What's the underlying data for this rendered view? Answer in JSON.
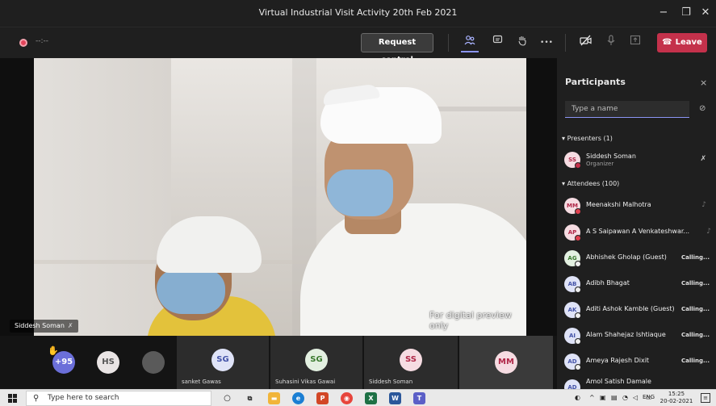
{
  "window": {
    "title": "Virtual Industrial Visit Activity 20th Feb 2021",
    "minimize": "−",
    "restore": "❐",
    "close": "✕"
  },
  "toolbar": {
    "timer": "--:--",
    "request_control": "Request control",
    "more": "•••",
    "leave": "Leave",
    "leave_icon": "☎"
  },
  "stage": {
    "presenter_name": "Siddesh Soman",
    "watermark": "For digital preview only"
  },
  "strip": {
    "overflow_count": "+95",
    "tiles": [
      {
        "initials": "HS",
        "label": ""
      },
      {
        "initials": "SG",
        "label": "sanket Gawas"
      },
      {
        "initials": "SG",
        "label": "Suhasini Vikas Gawai"
      },
      {
        "initials": "SS",
        "label": "Siddesh Soman"
      },
      {
        "initials": "MM",
        "label": ""
      }
    ]
  },
  "panel": {
    "title": "Participants",
    "close": "×",
    "search_placeholder": "Type a name",
    "presenters_header": "Presenters (1)",
    "attendees_header": "Attendees (100)",
    "presenters": [
      {
        "initials": "SS",
        "name": "Siddesh Soman",
        "role": "Organizer"
      }
    ],
    "attendees": [
      {
        "initials": "MM",
        "name": "Meenakshi Malhotra",
        "status": "",
        "color": "#e0404f"
      },
      {
        "initials": "AP",
        "name": "A S Saipawan A Venkateshwar...",
        "status": "",
        "color": "#e0404f"
      },
      {
        "initials": "AG",
        "name": "Abhishek Gholap (Guest)",
        "status": "Calling...",
        "color": "#eeeeee"
      },
      {
        "initials": "AB",
        "name": "Adibh Bhagat",
        "status": "Calling...",
        "color": "#eeeeee"
      },
      {
        "initials": "AK",
        "name": "Aditi Ashok Kamble (Guest)",
        "status": "Calling...",
        "color": "#eeeeee"
      },
      {
        "initials": "AI",
        "name": "Alam Shahejaz Ishtiaque",
        "status": "Calling...",
        "color": "#eeeeee"
      },
      {
        "initials": "AD",
        "name": "Ameya Rajesh Dixit",
        "status": "Calling...",
        "color": "#eeeeee"
      },
      {
        "initials": "AD",
        "name": "Amol Satish Damale",
        "status": "",
        "color": "#eeeeee"
      }
    ]
  },
  "taskbar": {
    "search_placeholder": "Type here to search",
    "lang": "ENG",
    "time": "15:25",
    "date": "20-02-2021"
  }
}
